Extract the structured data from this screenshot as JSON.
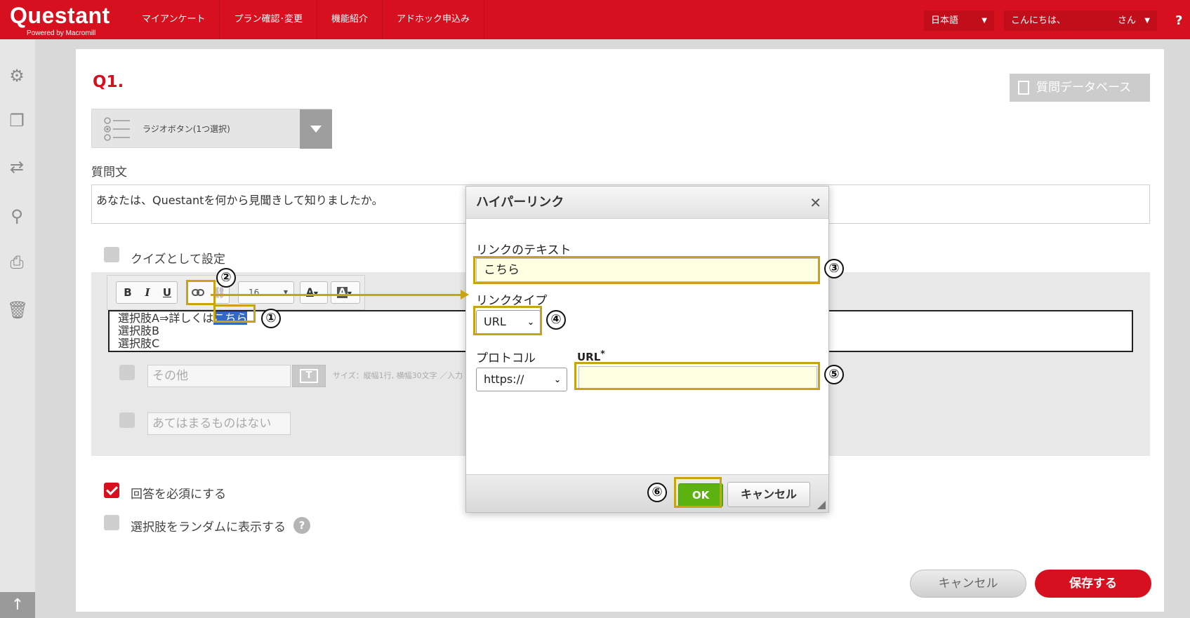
{
  "header": {
    "logo": "Questant",
    "logo_sub": "Powered by Macromill",
    "nav": [
      "マイアンケート",
      "プラン確認･変更",
      "機能紹介",
      "アドホック申込み"
    ],
    "language": "日本語",
    "greeting": "こんにちは、",
    "user_suffix": "さん",
    "help": "?"
  },
  "sidebar": {
    "icons": [
      "gear-icon",
      "copy-icon",
      "share-icon",
      "search-icon",
      "print-icon",
      "trash-icon"
    ],
    "scroll_top": "↑"
  },
  "question": {
    "number": "Q1.",
    "database_button": "質問データベース",
    "type_label": "ラジオボタン(1つ選択)",
    "text_label": "質問文",
    "text_value": "あなたは、Questantを何から見聞きして知りましたか。",
    "quiz_label": "クイズとして設定",
    "toolbar": {
      "bold": "B",
      "italic": "I",
      "underline": "U",
      "font_size": "16"
    },
    "choices": {
      "line1_prefix": "選択肢A⇒詳しくは",
      "line1_selected": "こちら",
      "line2": "選択肢B",
      "line3": "選択肢C"
    },
    "other_placeholder": "その他",
    "other_size_note": "サイズ：縦幅1行, 横幅30文字 ／入力",
    "none_placeholder": "あてはまるものはない",
    "required_label": "回答を必須にする",
    "random_label": "選択肢をランダムに表示する",
    "cancel_button": "キャンセル",
    "save_button": "保存する"
  },
  "dialog": {
    "title": "ハイパーリンク",
    "close": "✕",
    "link_text_label": "リンクのテキスト",
    "link_text_value": "こちら",
    "link_type_label": "リンクタイプ",
    "link_type_value": "URL",
    "protocol_label": "プロトコル",
    "protocol_value": "https://",
    "url_label": "URL",
    "url_required_mark": "*",
    "url_value": "",
    "ok_button": "OK",
    "cancel_button": "キャンセル"
  },
  "annotations": [
    "①",
    "②",
    "③",
    "④",
    "⑤",
    "⑥"
  ],
  "colors": {
    "brand_red": "#d6101e",
    "highlight_gold": "#c8a415",
    "ok_green": "#5cb30f",
    "input_yellow": "#ffffe1",
    "selection_blue": "#316ac5"
  }
}
